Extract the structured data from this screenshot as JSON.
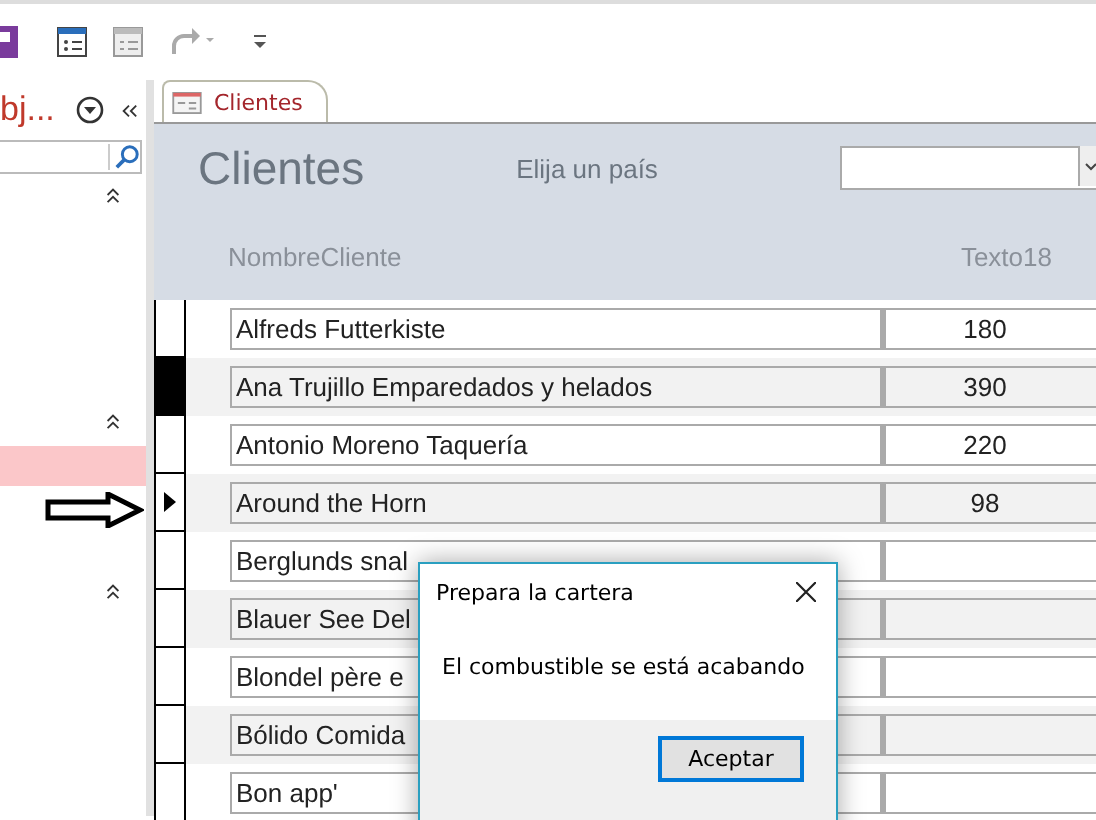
{
  "navigation_pane": {
    "title": "bj..."
  },
  "tab": {
    "label": "Clientes",
    "selected": true
  },
  "form": {
    "title": "Clientes",
    "filter_label": "Elija un país",
    "columns": [
      "NombreCliente",
      "Texto18"
    ],
    "rows": [
      {
        "name": "Alfreds Futterkiste",
        "value": "180",
        "selected": false,
        "current": false
      },
      {
        "name": "Ana Trujillo Emparedados y helados",
        "value": "390",
        "selected": true,
        "current": false
      },
      {
        "name": "Antonio Moreno Taquería",
        "value": "220",
        "selected": false,
        "current": false
      },
      {
        "name": "Around the Horn",
        "value": "98",
        "selected": false,
        "current": true
      },
      {
        "name": "Berglunds snal",
        "selected": false,
        "current": false
      },
      {
        "name": "Blauer See Del",
        "selected": false,
        "current": false
      },
      {
        "name": "Blondel père e",
        "selected": false,
        "current": false
      },
      {
        "name": "Bólido Comida",
        "selected": false,
        "current": false
      },
      {
        "name": "Bon app'",
        "selected": false,
        "current": false
      }
    ]
  },
  "dialog": {
    "title": "Prepara la cartera",
    "message": "El combustible se está acabando",
    "button": "Aceptar"
  }
}
